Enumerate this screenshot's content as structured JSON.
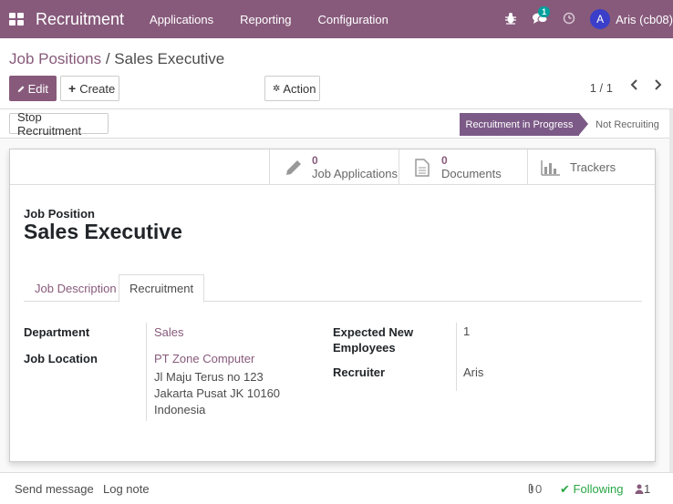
{
  "topbar": {
    "brand": "Recruitment",
    "menu": [
      "Applications",
      "Reporting",
      "Configuration"
    ],
    "chat_badge": "1",
    "avatar_letter": "A",
    "user": "Aris (cb08)",
    "bg_color": "#875a7b"
  },
  "breadcrumb": {
    "parent": "Job Positions",
    "sep": " / ",
    "current": "Sales Executive"
  },
  "buttons": {
    "edit": "Edit",
    "create": "Create",
    "action": "Action",
    "stop_recruitment": "Stop Recruitment"
  },
  "pager": {
    "text": "1 / 1"
  },
  "status": {
    "active": "Recruitment in Progress",
    "inactive": "Not Recruiting"
  },
  "smart_buttons": [
    {
      "value": "0",
      "label": "Job Applications",
      "icon": "pencil-icon"
    },
    {
      "value": "0",
      "label": "Documents",
      "icon": "file-icon"
    },
    {
      "value": "",
      "label": "Trackers",
      "icon": "bar-chart-icon"
    }
  ],
  "form": {
    "position_label": "Job Position",
    "position_name": "Sales Executive",
    "tabs": [
      "Job Description",
      "Recruitment"
    ],
    "fields": {
      "department_label": "Department",
      "department_value": "Sales",
      "location_label": "Job Location",
      "location_name": "PT Zone Computer",
      "location_address1": "Jl Maju Terus no 123",
      "location_address2": "Jakarta Pusat JK 10160",
      "location_country": "Indonesia",
      "expected_label_1": "Expected New",
      "expected_label_2": "Employees",
      "expected_value": "1",
      "recruiter_label": "Recruiter",
      "recruiter_value": "Aris"
    }
  },
  "chatter": {
    "send_message": "Send message",
    "log_note": "Log note",
    "attachments": "0",
    "following": "Following",
    "followers": "1"
  }
}
